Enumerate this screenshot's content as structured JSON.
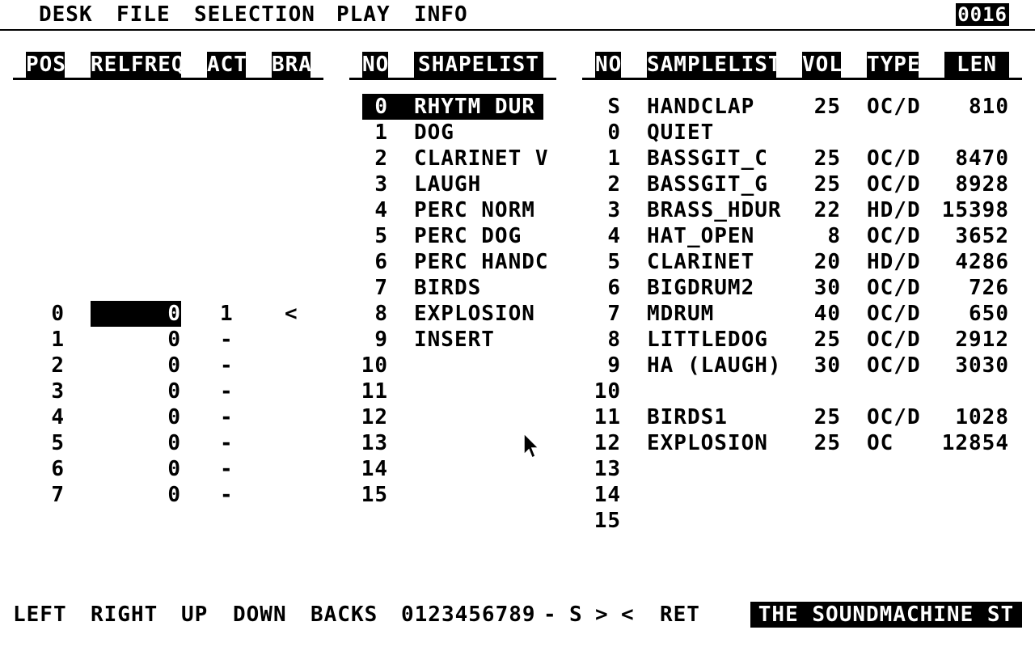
{
  "menu": {
    "desk": "DESK",
    "file": "FILE",
    "selection": "SELECTION",
    "play": "PLAY",
    "info": "INFO",
    "counter": "0016"
  },
  "headers": {
    "pos": "POS",
    "relfreq": "RELFREQ",
    "act": "ACT",
    "bra": "BRA",
    "shape_no": "NO",
    "shapelist": "SHAPELIST",
    "sample_no": "NO",
    "samplelist": "SAMPLELIST",
    "vol": "VOL",
    "type": "TYPE",
    "len": "LEN"
  },
  "positions": [
    {
      "pos": "0",
      "relfreq": "0",
      "act": "1",
      "bra": "<"
    },
    {
      "pos": "1",
      "relfreq": "0",
      "act": "-",
      "bra": ""
    },
    {
      "pos": "2",
      "relfreq": "0",
      "act": "-",
      "bra": ""
    },
    {
      "pos": "3",
      "relfreq": "0",
      "act": "-",
      "bra": ""
    },
    {
      "pos": "4",
      "relfreq": "0",
      "act": "-",
      "bra": ""
    },
    {
      "pos": "5",
      "relfreq": "0",
      "act": "-",
      "bra": ""
    },
    {
      "pos": "6",
      "relfreq": "0",
      "act": "-",
      "bra": ""
    },
    {
      "pos": "7",
      "relfreq": "0",
      "act": "-",
      "bra": ""
    }
  ],
  "shapes": [
    {
      "no": "0",
      "name": "RHYTM DUR"
    },
    {
      "no": "1",
      "name": "DOG"
    },
    {
      "no": "2",
      "name": "CLARINET V"
    },
    {
      "no": "3",
      "name": "LAUGH"
    },
    {
      "no": "4",
      "name": "PERC NORM"
    },
    {
      "no": "5",
      "name": "PERC DOG"
    },
    {
      "no": "6",
      "name": "PERC HANDC"
    },
    {
      "no": "7",
      "name": "BIRDS"
    },
    {
      "no": "8",
      "name": "EXPLOSION"
    },
    {
      "no": "9",
      "name": "INSERT"
    },
    {
      "no": "10",
      "name": ""
    },
    {
      "no": "11",
      "name": ""
    },
    {
      "no": "12",
      "name": ""
    },
    {
      "no": "13",
      "name": ""
    },
    {
      "no": "14",
      "name": ""
    },
    {
      "no": "15",
      "name": ""
    }
  ],
  "samples": [
    {
      "no": "S",
      "name": "HANDCLAP",
      "vol": "25",
      "type": "OC/D",
      "len": "810"
    },
    {
      "no": "0",
      "name": "QUIET",
      "vol": "",
      "type": "",
      "len": ""
    },
    {
      "no": "1",
      "name": "BASSGIT_C",
      "vol": "25",
      "type": "OC/D",
      "len": "8470"
    },
    {
      "no": "2",
      "name": "BASSGIT_G",
      "vol": "25",
      "type": "OC/D",
      "len": "8928"
    },
    {
      "no": "3",
      "name": "BRASS_HDUR",
      "vol": "22",
      "type": "HD/D",
      "len": "15398"
    },
    {
      "no": "4",
      "name": "HAT_OPEN",
      "vol": "8",
      "type": "OC/D",
      "len": "3652"
    },
    {
      "no": "5",
      "name": "CLARINET",
      "vol": "20",
      "type": "HD/D",
      "len": "4286"
    },
    {
      "no": "6",
      "name": "BIGDRUM2",
      "vol": "30",
      "type": "OC/D",
      "len": "726"
    },
    {
      "no": "7",
      "name": "MDRUM",
      "vol": "40",
      "type": "OC/D",
      "len": "650"
    },
    {
      "no": "8",
      "name": "LITTLEDOG",
      "vol": "25",
      "type": "OC/D",
      "len": "2912"
    },
    {
      "no": "9",
      "name": "HA (LAUGH)",
      "vol": "30",
      "type": "OC/D",
      "len": "3030"
    },
    {
      "no": "10",
      "name": "",
      "vol": "",
      "type": "",
      "len": ""
    },
    {
      "no": "11",
      "name": "BIRDS1",
      "vol": "25",
      "type": "OC/D",
      "len": "1028"
    },
    {
      "no": "12",
      "name": "EXPLOSION",
      "vol": "25",
      "type": "OC",
      "len": "12854"
    },
    {
      "no": "13",
      "name": "",
      "vol": "",
      "type": "",
      "len": ""
    },
    {
      "no": "14",
      "name": "",
      "vol": "",
      "type": "",
      "len": ""
    },
    {
      "no": "15",
      "name": "",
      "vol": "",
      "type": "",
      "len": ""
    }
  ],
  "footer": {
    "left": "LEFT",
    "right": "RIGHT",
    "up": "UP",
    "down": "DOWN",
    "backs": "BACKS",
    "digits": "0123456789",
    "dash": "-",
    "s": "S",
    "gt": ">",
    "lt": "<",
    "ret": "RET",
    "title": "THE SOUNDMACHINE ST"
  },
  "icons": {
    "cursor": "mouse-pointer-icon"
  }
}
